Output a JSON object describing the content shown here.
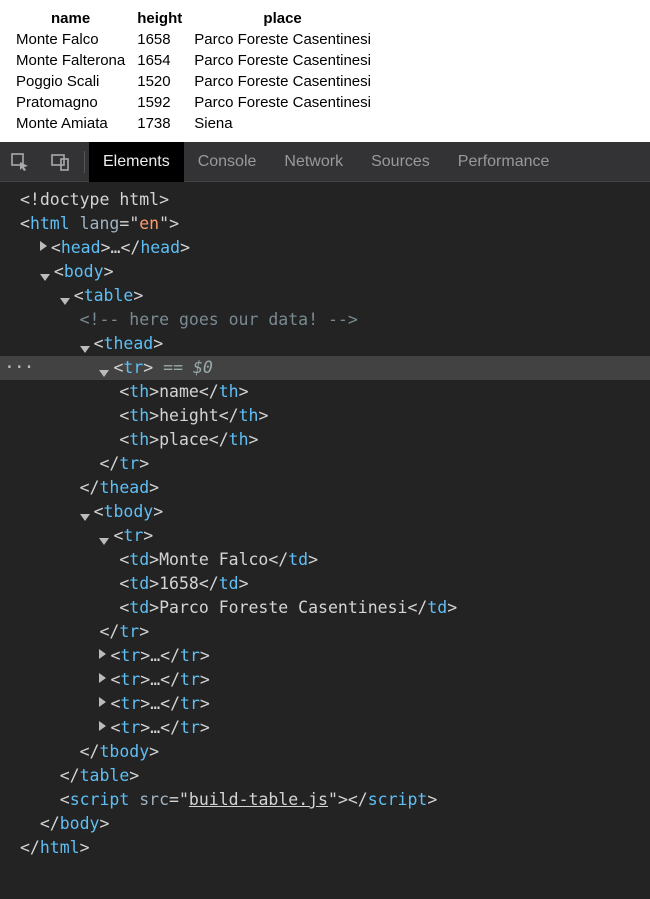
{
  "table": {
    "headers": [
      "name",
      "height",
      "place"
    ],
    "rows": [
      [
        "Monte Falco",
        "1658",
        "Parco Foreste Casentinesi"
      ],
      [
        "Monte Falterona",
        "1654",
        "Parco Foreste Casentinesi"
      ],
      [
        "Poggio Scali",
        "1520",
        "Parco Foreste Casentinesi"
      ],
      [
        "Pratomagno",
        "1592",
        "Parco Foreste Casentinesi"
      ],
      [
        "Monte Amiata",
        "1738",
        "Siena"
      ]
    ]
  },
  "devtools": {
    "tabs": [
      "Elements",
      "Console",
      "Network",
      "Sources",
      "Performance"
    ],
    "activeTab": "Elements"
  },
  "source": {
    "doctype": "<!doctype html>",
    "htmlTag": "html",
    "htmlLangAttr": "lang",
    "htmlLangVal": "en",
    "headTag": "head",
    "bodyTag": "body",
    "tableTag": "table",
    "comment": "<!-- here goes our data! -->",
    "theadTag": "thead",
    "trTag": "tr",
    "thTag": "th",
    "tbodyTag": "tbody",
    "tdTag": "td",
    "scriptTag": "script",
    "scriptSrcAttr": "src",
    "scriptSrcVal": "build-table.js",
    "selectedMark": "== $0",
    "ellipsis": "…",
    "th1": "name",
    "th2": "height",
    "th3": "place",
    "td1": "Monte Falco",
    "td2": "1658",
    "td3": "Parco Foreste Casentinesi",
    "gutterDots": "···"
  }
}
